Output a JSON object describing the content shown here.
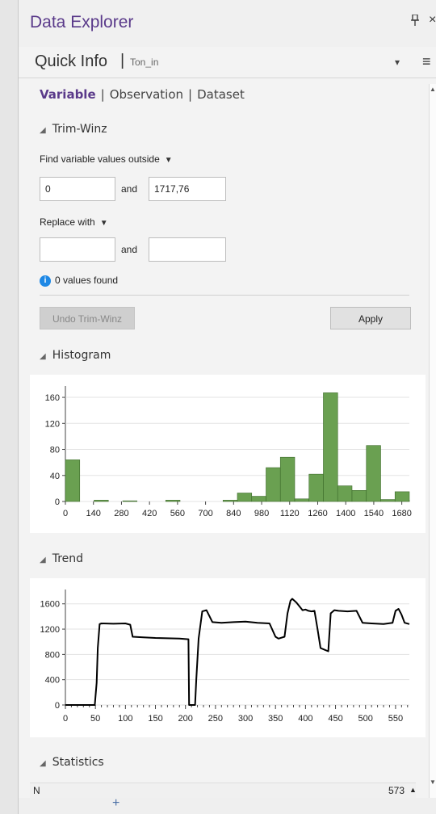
{
  "window": {
    "title": "Data Explorer",
    "pin_icon": "pin-icon",
    "close_glyph": "×"
  },
  "quick_info": {
    "title": "Quick Info",
    "separator": "|",
    "variable": "Ton_in",
    "dropdown_glyph": "▾",
    "menu_glyph": "≡"
  },
  "tabs": {
    "active": "Variable",
    "sep": "|",
    "items": [
      "Variable",
      "Observation",
      "Dataset"
    ]
  },
  "trimwinz": {
    "header": "Trim-Winz",
    "find_label": "Find variable values outside",
    "find_low": "0",
    "find_high": "1717,76",
    "and_label": "and",
    "replace_label": "Replace with",
    "replace_low": "",
    "replace_high": "",
    "found_text": "0 values found",
    "info_glyph": "i",
    "undo_label": "Undo Trim-Winz",
    "apply_label": "Apply"
  },
  "histogram": {
    "header": "Histogram"
  },
  "trend": {
    "header": "Trend"
  },
  "statistics": {
    "header": "Statistics",
    "row_label": "N",
    "row_value": "573"
  },
  "colors": {
    "accent": "#5a3a8a",
    "bar_fill": "#6aa051",
    "bar_stroke": "#3c6a2a",
    "line": "#000000"
  },
  "chart_data": [
    {
      "type": "bar",
      "title": "",
      "xlabel": "",
      "ylabel": "",
      "xlim": [
        0,
        1717.76
      ],
      "ylim": [
        0,
        170
      ],
      "x_ticks": [
        0,
        140,
        280,
        420,
        560,
        700,
        840,
        980,
        1120,
        1260,
        1400,
        1540,
        1680
      ],
      "y_ticks": [
        0,
        40,
        80,
        120,
        160
      ],
      "bin_width": 71.57,
      "bin_starts": [
        0,
        71.57,
        143.15,
        214.72,
        286.29,
        357.87,
        429.44,
        501.01,
        572.59,
        644.16,
        715.73,
        787.31,
        858.88,
        930.45,
        1002.03,
        1073.6,
        1145.17,
        1216.75,
        1288.32,
        1359.89,
        1431.47,
        1503.04,
        1574.61,
        1646.19
      ],
      "values": [
        64,
        0,
        2,
        0,
        1,
        0,
        0,
        2,
        0,
        0,
        0,
        2,
        13,
        8,
        52,
        68,
        4,
        42,
        167,
        24,
        17,
        86,
        3,
        15,
        2
      ]
    },
    {
      "type": "line",
      "title": "",
      "xlabel": "",
      "ylabel": "",
      "xlim": [
        0,
        573
      ],
      "ylim": [
        0,
        1750
      ],
      "x_ticks": [
        0,
        50,
        100,
        150,
        200,
        250,
        300,
        350,
        400,
        450,
        500,
        550
      ],
      "y_ticks": [
        0,
        400,
        800,
        1200,
        1600
      ],
      "x": [
        0,
        49,
        52,
        54,
        57,
        60,
        80,
        100,
        108,
        112,
        130,
        150,
        170,
        190,
        205,
        206,
        208,
        212,
        216,
        218,
        222,
        228,
        235,
        245,
        260,
        280,
        300,
        320,
        340,
        350,
        355,
        365,
        370,
        375,
        378,
        385,
        395,
        400,
        405,
        410,
        415,
        420,
        425,
        430,
        438,
        442,
        448,
        455,
        470,
        485,
        495,
        510,
        530,
        545,
        550,
        555,
        560,
        565,
        573
      ],
      "y": [
        0,
        0,
        350,
        900,
        1280,
        1290,
        1285,
        1290,
        1270,
        1080,
        1070,
        1060,
        1055,
        1050,
        1040,
        0,
        0,
        0,
        0,
        400,
        1050,
        1480,
        1500,
        1310,
        1300,
        1310,
        1320,
        1300,
        1290,
        1080,
        1050,
        1080,
        1450,
        1650,
        1680,
        1620,
        1500,
        1510,
        1490,
        1480,
        1490,
        1200,
        900,
        880,
        850,
        1450,
        1500,
        1490,
        1480,
        1490,
        1300,
        1290,
        1280,
        1300,
        1490,
        1520,
        1430,
        1300,
        1280
      ]
    }
  ]
}
